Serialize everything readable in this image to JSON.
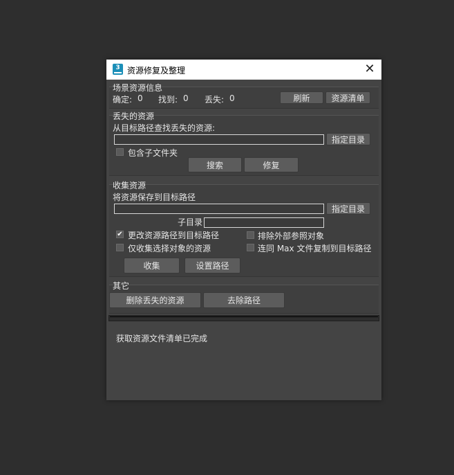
{
  "window": {
    "title": "资源修复及整理",
    "app_icon_text": "3"
  },
  "scene_info": {
    "header": "场景资源信息",
    "confirmed_label": "确定:",
    "confirmed_value": "0",
    "found_label": "找到:",
    "found_value": "0",
    "missing_label": "丢失:",
    "missing_value": "0",
    "refresh_label": "刷新",
    "asset_list_label": "资源清单"
  },
  "missing": {
    "header": "丢失的资源",
    "search_label": "从目标路径查找丢失的资源:",
    "path_value": "",
    "browse_label": "指定目录",
    "include_subfolders_label": "包含子文件夹",
    "include_subfolders_checked": false,
    "search_button": "搜索",
    "repair_button": "修复"
  },
  "collect": {
    "header": "收集资源",
    "save_label": "将资源保存到目标路径",
    "path_value": "",
    "browse_label": "指定目录",
    "subdir_label": "子目录",
    "subdir_value": "",
    "opt_update_paths": "更改资源路径到目标路径",
    "opt_update_paths_checked": true,
    "opt_exclude_xref": "排除外部参照对象",
    "opt_exclude_xref_checked": false,
    "opt_selected_only": "仅收集选择对象的资源",
    "opt_selected_only_checked": false,
    "opt_copy_max": "连同 Max 文件复制到目标路径",
    "opt_copy_max_checked": false,
    "collect_button": "收集",
    "set_path_button": "设置路径"
  },
  "other": {
    "header": "其它",
    "delete_missing_button": "删除丢失的资源",
    "strip_path_button": "去除路径"
  },
  "status": {
    "message": "获取资源文件清单已完成"
  }
}
